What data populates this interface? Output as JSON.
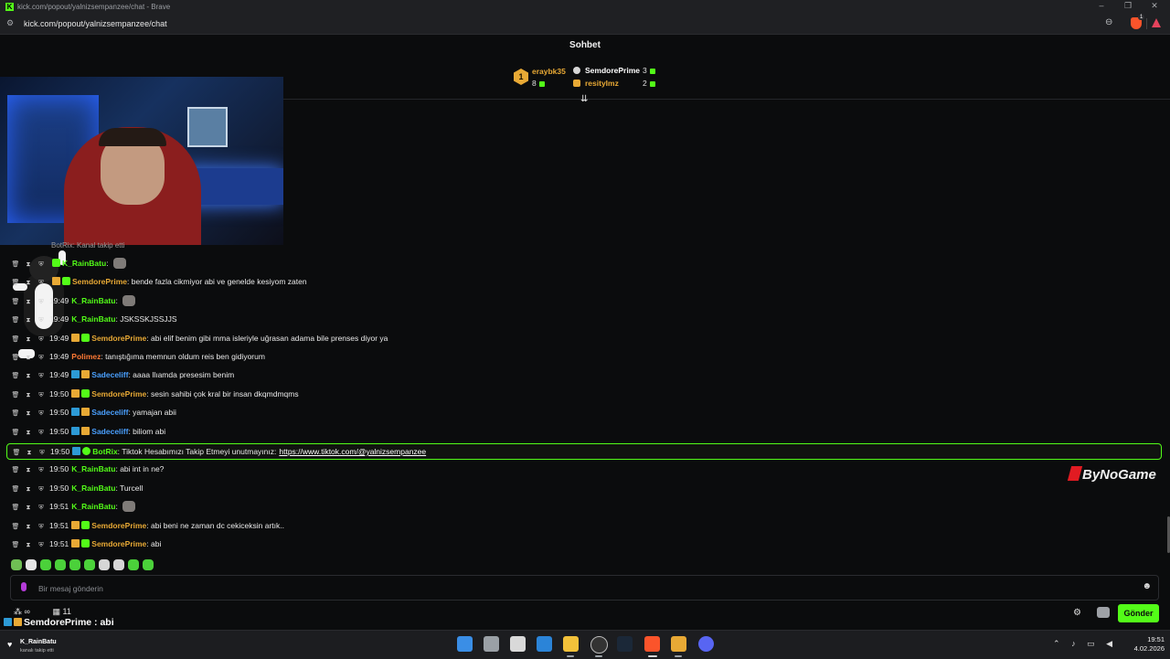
{
  "browser": {
    "window_title": "kick.com/popout/yalnizsempanzee/chat - Brave",
    "url": "kick.com/popout/yalnizsempanzee/chat",
    "shield_count": "1"
  },
  "chat": {
    "title": "Sohbet",
    "leaderboard": {
      "rank": "1",
      "first": {
        "name": "eraybk35",
        "count": "8",
        "color": "#e8a935"
      },
      "second": {
        "name": "SemdorePrime",
        "count": "3",
        "color": "#ffffff"
      },
      "third": {
        "name": "resityImz",
        "count": "2",
        "color": "#e8a935"
      }
    },
    "partial_line": "BotRix: Kanal takip etti",
    "messages": [
      {
        "time": "",
        "user": "K_RainBatu",
        "user_color": "#53fc18",
        "badges": [
          "gift"
        ],
        "text": "",
        "emote": true
      },
      {
        "time": "",
        "user": "SemdorePrime",
        "user_color": "#e8a935",
        "badges": [
          "crown",
          "gift"
        ],
        "text": "bende fazla cikmiyor abi ve genelde kesiyom zaten",
        "emote": false
      },
      {
        "time": "19:49",
        "user": "K_RainBatu",
        "user_color": "#53fc18",
        "badges": [],
        "text": "",
        "emote": true
      },
      {
        "time": "19:49",
        "user": "K_RainBatu",
        "user_color": "#53fc18",
        "badges": [],
        "text": "JSKSSKJSSJJS",
        "emote": false
      },
      {
        "time": "19:49",
        "user": "SemdorePrime",
        "user_color": "#e8a935",
        "badges": [
          "crown",
          "gift"
        ],
        "text": "abi elif benim gibi mma isleriyle uğrasan adama bile prenses diyor ya",
        "emote": false
      },
      {
        "time": "19:49",
        "user": "Polimez",
        "user_color": "#ff7a35",
        "badges": [],
        "text": "tanıştığıma memnun oldum reis ben gidiyorum",
        "emote": false
      },
      {
        "time": "19:49",
        "user": "Sadeceliff",
        "user_color": "#4aa0ff",
        "badges": [
          "sub",
          "crown"
        ],
        "text": "aaaa llıamda presesim benim",
        "emote": false
      },
      {
        "time": "19:50",
        "user": "SemdorePrime",
        "user_color": "#e8a935",
        "badges": [
          "crown",
          "gift"
        ],
        "text": "sesin sahibi çok kral bir insan dkqmdmqms",
        "emote": false
      },
      {
        "time": "19:50",
        "user": "Sadeceliff",
        "user_color": "#4aa0ff",
        "badges": [
          "sub",
          "crown"
        ],
        "text": "yamajan abii",
        "emote": false
      },
      {
        "time": "19:50",
        "user": "Sadeceliff",
        "user_color": "#4aa0ff",
        "badges": [
          "sub",
          "crown"
        ],
        "text": "biliom abi",
        "emote": false
      },
      {
        "time": "19:50",
        "user": "BotRix",
        "user_color": "#53fc18",
        "badges": [
          "sub",
          "bot"
        ],
        "text": "Tiktok Hesabımızı Takip Etmeyi unutmayınız:",
        "link": "https://www.tiktok.com/@yalnizsempanzee",
        "highlight": true,
        "emote": false
      },
      {
        "time": "19:50",
        "user": "K_RainBatu",
        "user_color": "#53fc18",
        "badges": [],
        "text": "abi int in ne?",
        "emote": false
      },
      {
        "time": "19:50",
        "user": "K_RainBatu",
        "user_color": "#53fc18",
        "badges": [],
        "text": "Turcell",
        "emote": false
      },
      {
        "time": "19:51",
        "user": "K_RainBatu",
        "user_color": "#53fc18",
        "badges": [],
        "text": "",
        "emote": true
      },
      {
        "time": "19:51",
        "user": "SemdorePrime",
        "user_color": "#e8a935",
        "badges": [
          "crown",
          "gift"
        ],
        "text": "abi beni ne zaman dc cekiceksin artık..",
        "emote": false
      },
      {
        "time": "19:51",
        "user": "SemdorePrime",
        "user_color": "#e8a935",
        "badges": [
          "crown",
          "gift"
        ],
        "text": "abi",
        "emote": false
      }
    ],
    "input_placeholder": "Bir mesaj gönderin",
    "send_label": "Gönder",
    "stats": {
      "infinity": "∞",
      "calendar_count": "11"
    },
    "last_message": "SemdorePrime : abi",
    "sponsor": "ByNoGame"
  },
  "taskbar": {
    "notification_user": "K_RainBatu",
    "notification_text": "kanalı takip etti",
    "time": "19:51",
    "date": "4.02.2026"
  }
}
